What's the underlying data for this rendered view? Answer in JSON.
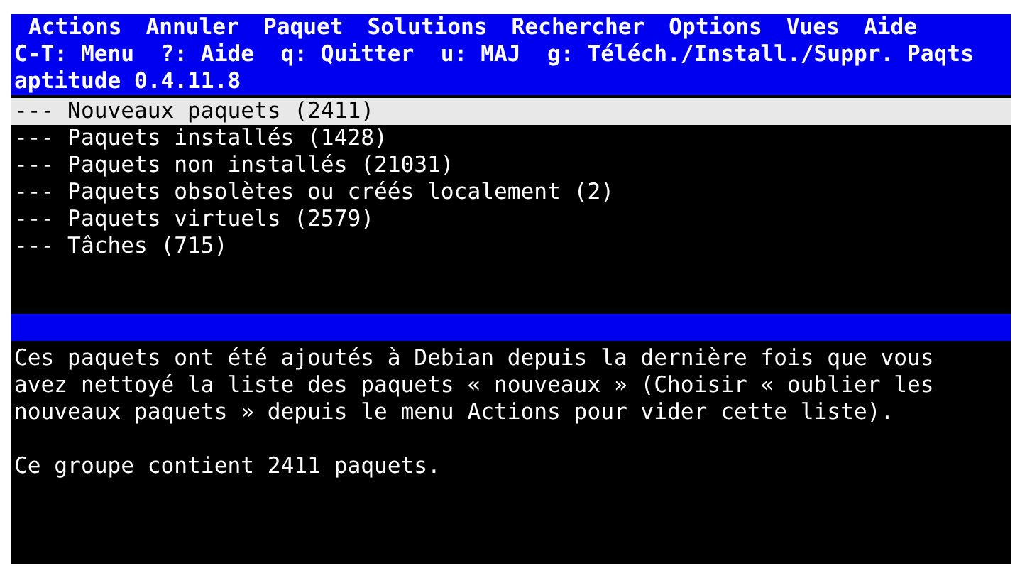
{
  "menu_bar": {
    "items": [
      "Actions",
      "Annuler",
      "Paquet",
      "Solutions",
      "Rechercher",
      "Options",
      "Vues",
      "Aide"
    ]
  },
  "shortcut_bar": {
    "text": "C-T: Menu  ?: Aide  q: Quitter  u: MAJ  g: Téléch./Install./Suppr. Paqts"
  },
  "title_bar": {
    "text": "aptitude 0.4.11.8"
  },
  "tree": {
    "items": [
      {
        "label": "--- Nouveaux paquets (2411)",
        "selected": true
      },
      {
        "label": "--- Paquets installés (1428)",
        "selected": false
      },
      {
        "label": "--- Paquets non installés (21031)",
        "selected": false
      },
      {
        "label": "--- Paquets obsolètes ou créés localement (2)",
        "selected": false
      },
      {
        "label": "--- Paquets virtuels (2579)",
        "selected": false
      },
      {
        "label": "--- Tâches (715)",
        "selected": false
      }
    ]
  },
  "description": {
    "paragraphs": [
      [
        "Ces paquets ont été ajoutés à Debian depuis la dernière fois que vous",
        "avez nettoyé la liste des paquets « nouveaux » (Choisir « oublier les",
        "nouveaux paquets » depuis le menu Actions pour vider cette liste)."
      ],
      [
        "Ce groupe contient 2411 paquets."
      ]
    ]
  }
}
